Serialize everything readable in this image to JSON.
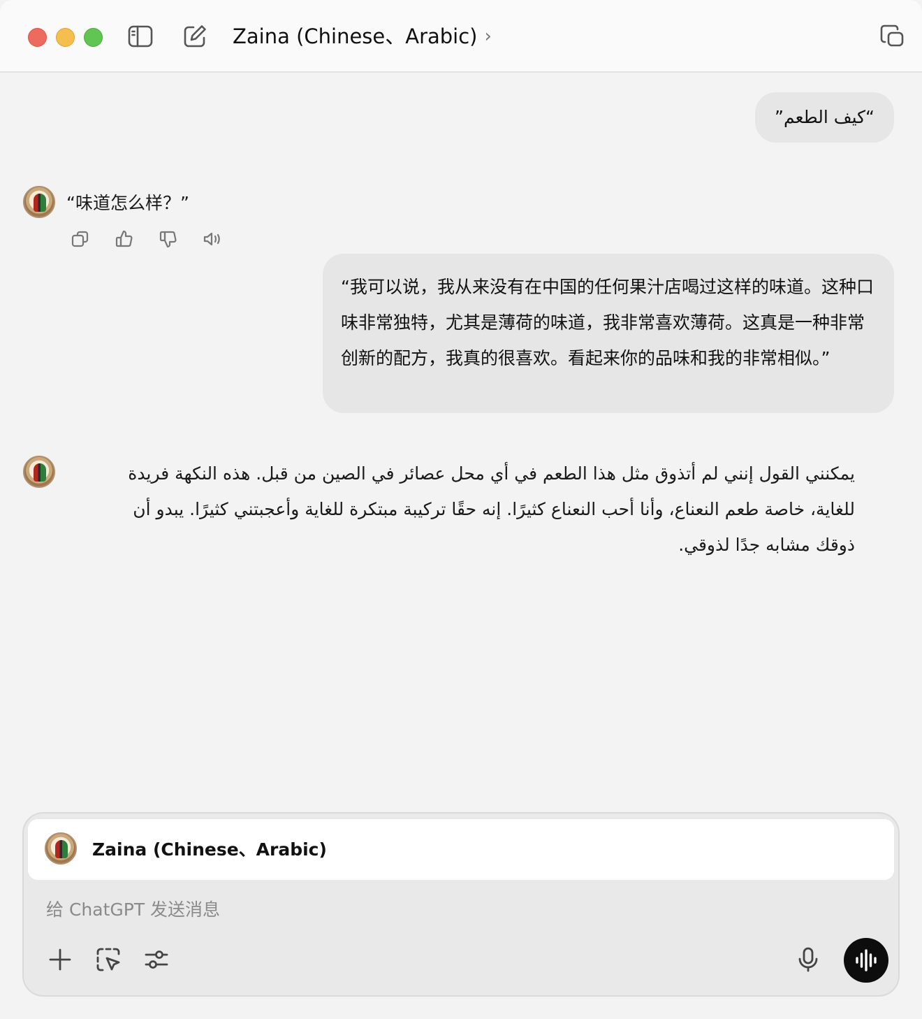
{
  "window": {
    "title": "Zaina (Chinese、Arabic)",
    "title_chevron": "›",
    "traffic_lights": [
      "#ed6a5e",
      "#f5bf4f",
      "#61c554"
    ],
    "icons": [
      "sidebar-toggle-icon",
      "new-chat-icon",
      "new-window-icon"
    ]
  },
  "messages": [
    {
      "role": "user",
      "text": "“كيف الطعم”"
    },
    {
      "role": "assistant",
      "text": "“味道怎么样？”",
      "actions": [
        "copy-icon",
        "thumbs-up-icon",
        "thumbs-down-icon",
        "read-aloud-icon"
      ]
    },
    {
      "role": "user",
      "text": "“我可以说，我从来没有在中国的任何果汁店喝过这样的味道。这种口味非常独特，尤其是薄荷的味道，我非常喜欢薄荷。这真是一种非常创新的配方，我真的很喜欢。看起来你的品味和我的非常相似。”"
    },
    {
      "role": "assistant",
      "text": "يمكنني القول إنني لم أتذوق مثل هذا الطعم في أي محل عصائر في الصين من قبل. هذه النكهة فريدة للغاية، خاصة طعم النعناع، وأنا أحب النعناع كثيرًا. إنه حقًا تركيبة مبتكرة للغاية وأعجبتني كثيرًا. يبدو أن ذوقك مشابه جدًا لذوقي."
    }
  ],
  "composer": {
    "gpt_name": "Zaina (Chinese、Arabic)",
    "placeholder": "给 ChatGPT 发送消息",
    "tools": [
      "plus-icon",
      "select-area-icon",
      "tools-sliders-icon"
    ],
    "right_icons": [
      "microphone-icon",
      "voice-mode-icon"
    ]
  },
  "colors": {
    "background": "#f3f3f3",
    "bubble": "#e6e6e6",
    "voice_button": "#0d0d0d"
  }
}
